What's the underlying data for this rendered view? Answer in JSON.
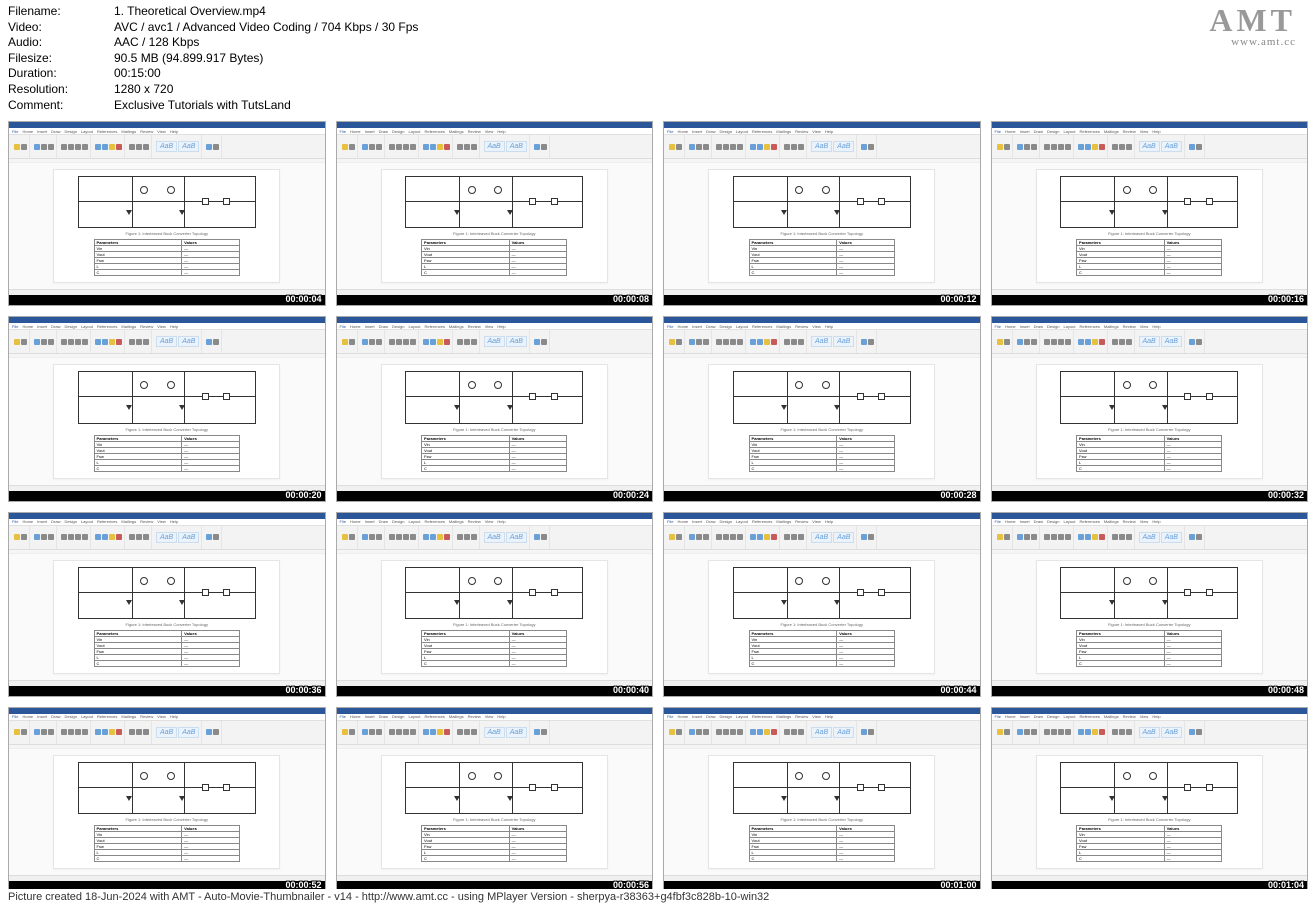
{
  "meta": {
    "labels": {
      "filename": "Filename:",
      "video": "Video:",
      "audio": "Audio:",
      "filesize": "Filesize:",
      "duration": "Duration:",
      "resolution": "Resolution:",
      "comment": "Comment:"
    },
    "values": {
      "filename": "1. Theoretical Overview.mp4",
      "video": "AVC / avc1 / Advanced Video Coding / 704 Kbps / 30 Fps",
      "audio": "AAC / 128 Kbps",
      "filesize": "90.5 MB (94.899.917 Bytes)",
      "duration": "00:15:00",
      "resolution": "1280 x 720",
      "comment": "Exclusive Tutorials with TutsLand"
    }
  },
  "watermark": {
    "big": "AMT",
    "small": "www.amt.cc"
  },
  "ribbon_tabs": [
    "File",
    "Home",
    "Insert",
    "Draw",
    "Design",
    "Layout",
    "References",
    "Mailings",
    "Review",
    "View",
    "Help"
  ],
  "styles_label": "AaB",
  "figure_caption": "Figure 1: Interleaved Buck Converter Topology",
  "param_table": {
    "headers": [
      "Parameters",
      "Values"
    ],
    "rows": [
      [
        "Vin",
        "—"
      ],
      [
        "Vout",
        "—"
      ],
      [
        "Fsw",
        "—"
      ],
      [
        "L",
        "—"
      ],
      [
        "C",
        "—"
      ]
    ]
  },
  "timestamps": [
    "00:00:04",
    "00:00:08",
    "00:00:12",
    "00:00:16",
    "00:00:20",
    "00:00:24",
    "00:00:28",
    "00:00:32",
    "00:00:36",
    "00:00:40",
    "00:00:44",
    "00:00:48",
    "00:00:52",
    "00:00:56",
    "00:01:00",
    "00:01:04"
  ],
  "footer": "Picture created 18-Jun-2024 with AMT - Auto-Movie-Thumbnailer - v14 - http://www.amt.cc - using MPlayer Version - sherpya-r38363+g4fbf3c828b-10-win32"
}
